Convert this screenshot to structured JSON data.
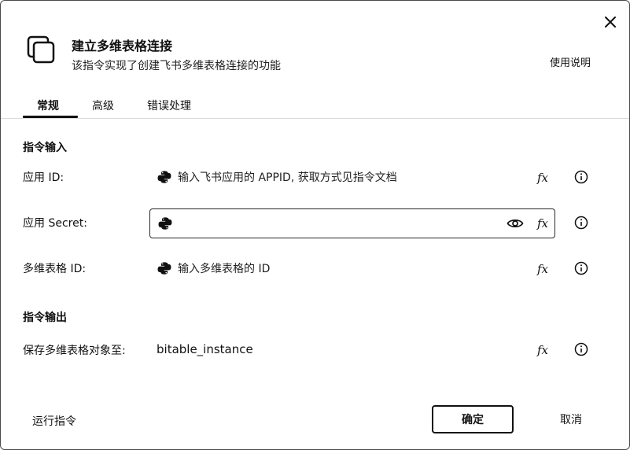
{
  "dialog": {
    "title": "建立多维表格连接",
    "subtitle": "该指令实现了创建飞书多维表格连接的功能",
    "help_link": "使用说明"
  },
  "tabs": [
    {
      "label": "常规",
      "active": true
    },
    {
      "label": "高级",
      "active": false
    },
    {
      "label": "错误处理",
      "active": false
    }
  ],
  "input_section": {
    "title": "指令输入",
    "fields": [
      {
        "label": "应用 ID:",
        "placeholder": "输入飞书应用的 APPID, 获取方式见指令文档",
        "value": ""
      },
      {
        "label": "应用 Secret:",
        "placeholder": "",
        "value": ""
      },
      {
        "label": "多维表格 ID:",
        "placeholder": "输入多维表格的 ID",
        "value": ""
      }
    ]
  },
  "output_section": {
    "title": "指令输出",
    "fields": [
      {
        "label": "保存多维表格对象至:",
        "value": "bitable_instance"
      }
    ]
  },
  "footer": {
    "run_label": "运行指令",
    "ok_label": "确定",
    "cancel_label": "取消"
  },
  "icons": {
    "fx": "fx",
    "close": "close-icon",
    "info": "info-icon",
    "eye": "eye-icon",
    "python": "python-icon"
  },
  "colors": {
    "border": "#2a2a2a",
    "text": "#111111",
    "background": "#ffffff"
  }
}
